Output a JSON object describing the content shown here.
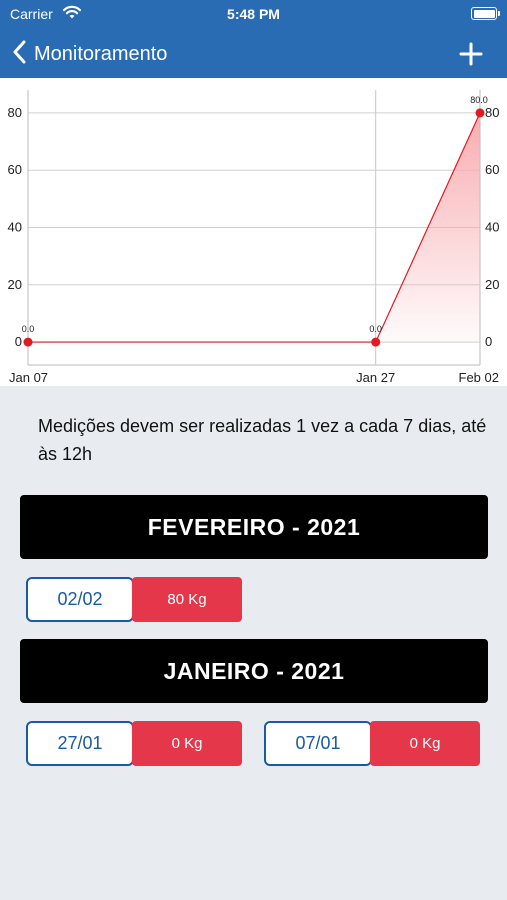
{
  "status_bar": {
    "carrier": "Carrier",
    "time": "5:48 PM"
  },
  "nav": {
    "title": "Monitoramento"
  },
  "chart_data": {
    "type": "area",
    "x_tick_labels": [
      "Jan 07",
      "Jan 27",
      "Feb 02"
    ],
    "x": [
      "Jan 07",
      "Jan 27",
      "Feb 02"
    ],
    "values": [
      0,
      0,
      80
    ],
    "value_labels": [
      "0.0",
      "0.0",
      "80.0"
    ],
    "y_ticks": [
      0,
      20,
      40,
      60,
      80
    ],
    "ylim": [
      -8,
      88
    ],
    "grid": true,
    "line_color": "#e01b24",
    "point_color": "#e01b24",
    "fill_color": "#f8a8ac"
  },
  "info": {
    "text": "Medições devem ser realizadas 1 vez a cada 7 dias, até às 12h"
  },
  "months": [
    {
      "title": "FEVEREIRO - 2021",
      "measurements": [
        {
          "date": "02/02",
          "weight": "80 Kg"
        }
      ]
    },
    {
      "title": "JANEIRO - 2021",
      "measurements": [
        {
          "date": "27/01",
          "weight": "0 Kg"
        },
        {
          "date": "07/01",
          "weight": "0 Kg"
        }
      ]
    }
  ]
}
